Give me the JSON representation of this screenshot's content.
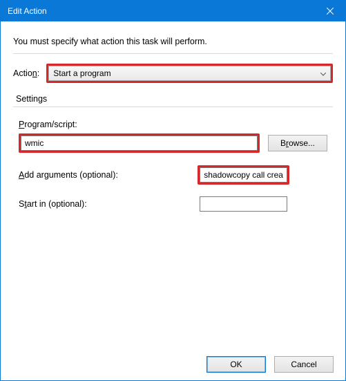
{
  "titlebar": {
    "title": "Edit Action"
  },
  "instruction": "You must specify what action this task will perform.",
  "action": {
    "label_pre": "Actio",
    "label_ul": "n",
    "label_post": ":",
    "selected": "Start a program"
  },
  "settings": {
    "legend": "Settings",
    "program": {
      "label_ul": "P",
      "label_post": "rogram/script:",
      "value": "wmic",
      "browse_ul": "r",
      "browse_pre": "B",
      "browse_post": "owse..."
    },
    "args": {
      "label_ul": "A",
      "label_post": "dd arguments (optional):",
      "value": "shadowcopy call create"
    },
    "startin": {
      "label_pre": "S",
      "label_ul": "t",
      "label_post": "art in (optional):",
      "value": ""
    }
  },
  "buttons": {
    "ok": "OK",
    "cancel": "Cancel"
  }
}
